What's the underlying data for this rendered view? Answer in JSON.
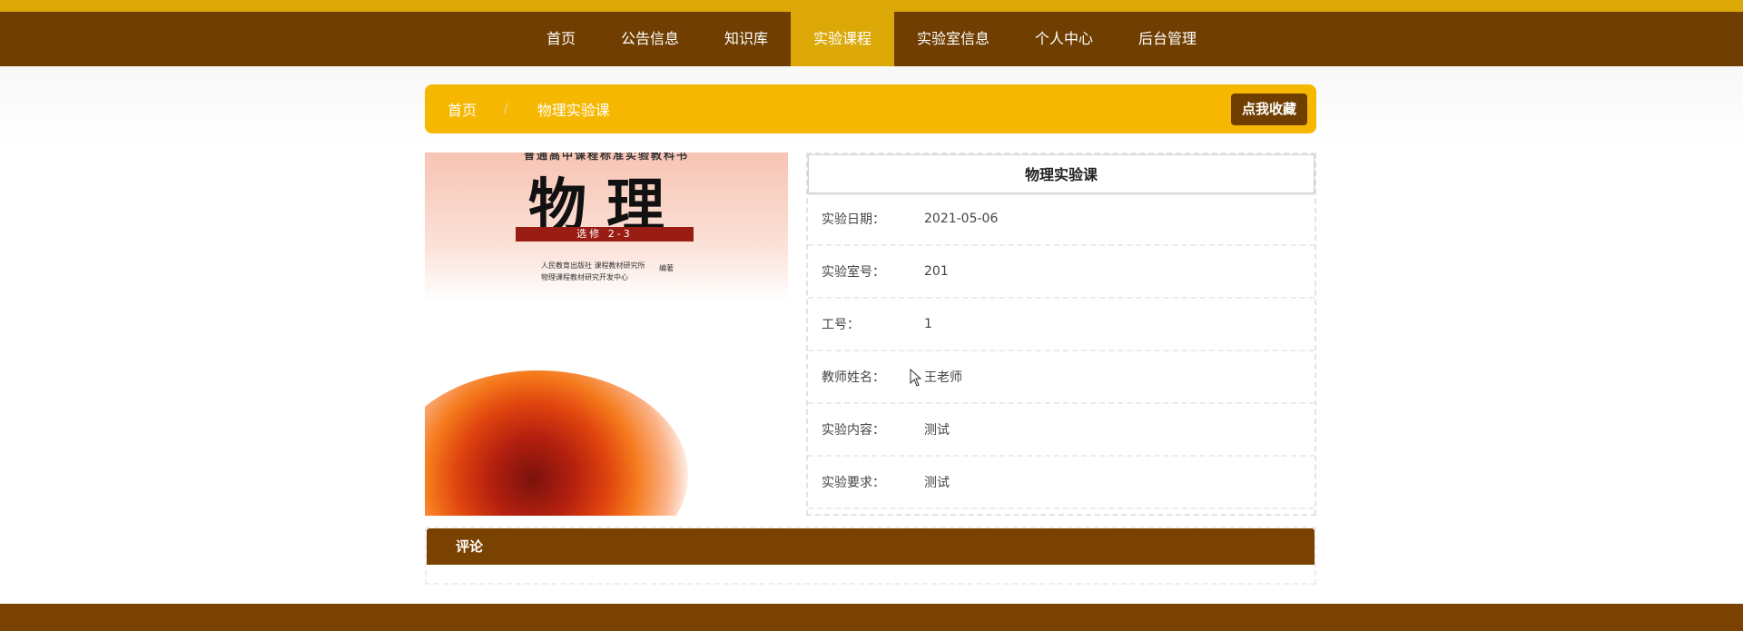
{
  "nav": {
    "items": [
      {
        "label": "首页"
      },
      {
        "label": "公告信息"
      },
      {
        "label": "知识库"
      },
      {
        "label": "实验课程"
      },
      {
        "label": "实验室信息"
      },
      {
        "label": "个人中心"
      },
      {
        "label": "后台管理"
      }
    ],
    "active_index": 3
  },
  "breadcrumb": {
    "home": "首页",
    "separator": "/",
    "current": "物理实验课"
  },
  "favorite_button": "点我收藏",
  "cover": {
    "series": "普通高中课程标准实验教科书",
    "title": "物理",
    "band": "选修 2-3",
    "publisher_line1": "人民教育出版社  课程教材研究所",
    "publisher_line2": "物理课程教材研究开发中心",
    "publisher_note": "编著"
  },
  "detail": {
    "title": "物理实验课",
    "rows": [
      {
        "label": "实验日期：",
        "value": "2021-05-06"
      },
      {
        "label": "实验室号：",
        "value": "201"
      },
      {
        "label": "工号：",
        "value": "1"
      },
      {
        "label": "教师姓名：",
        "value": "王老师"
      },
      {
        "label": "实验内容：",
        "value": "测试"
      },
      {
        "label": "实验要求：",
        "value": "测试"
      }
    ]
  },
  "comments": {
    "header": "评论"
  },
  "colors": {
    "nav_bg": "#6f3e00",
    "accent": "#dca808",
    "breadcrumb_bg": "#f6b700",
    "footer_bg": "#7a4200"
  }
}
